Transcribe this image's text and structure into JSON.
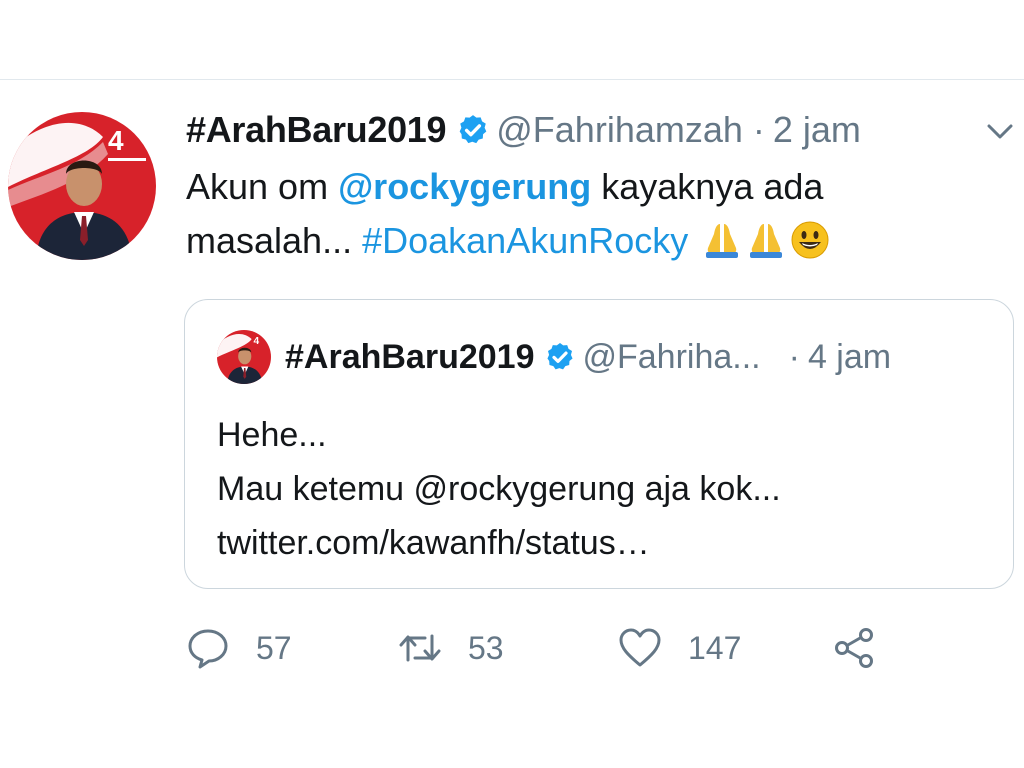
{
  "tweet": {
    "author_name": "#ArahBaru2019",
    "handle": "@Fahrihamzah",
    "separator": "·",
    "time": "2 jam",
    "text": {
      "part1": "Akun om ",
      "mention": "@rockygerung",
      "part2": " kayaknya ada masalah... ",
      "hashtag": "#DoakanAkunRocky",
      "emojis": [
        "folded-hands",
        "folded-hands",
        "smiling-face"
      ]
    }
  },
  "quoted_tweet": {
    "author_name": "#ArahBaru2019",
    "handle": "@Fahriha...",
    "separator": "·",
    "time": "4 jam",
    "lines": [
      "Hehe...",
      "Mau ketemu @rockygerung aja kok...",
      "twitter.com/kawanfh/status…"
    ]
  },
  "actions": {
    "reply_count": "57",
    "retweet_count": "53",
    "like_count": "147"
  },
  "avatar_badge": "4",
  "colors": {
    "link": "#1b95e0",
    "secondary_text": "#657786",
    "verified": "#1da1f2",
    "border": "#ccd6dd",
    "avatar_red": "#d7222a"
  }
}
